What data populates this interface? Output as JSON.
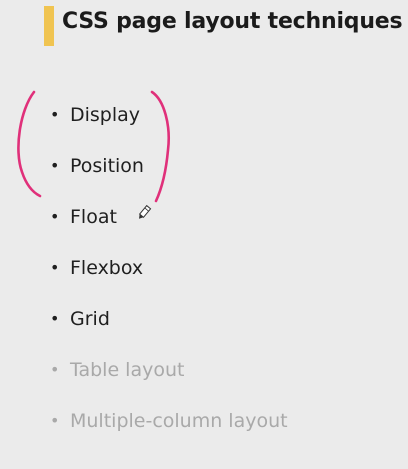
{
  "slide": {
    "title": "CSS page layout techniques",
    "accent_color": "#f0c451",
    "items": [
      {
        "label": "Display",
        "state": "active"
      },
      {
        "label": "Position",
        "state": "active"
      },
      {
        "label": "Float",
        "state": "active"
      },
      {
        "label": "Flexbox",
        "state": "active"
      },
      {
        "label": "Grid",
        "state": "active"
      },
      {
        "label": "Table layout",
        "state": "dimmed"
      },
      {
        "label": "Multiple-column layout",
        "state": "dimmed"
      }
    ],
    "bullet": "•"
  },
  "annotation": {
    "color": "#e0307a",
    "pen_icon": "pen-cursor-icon"
  }
}
